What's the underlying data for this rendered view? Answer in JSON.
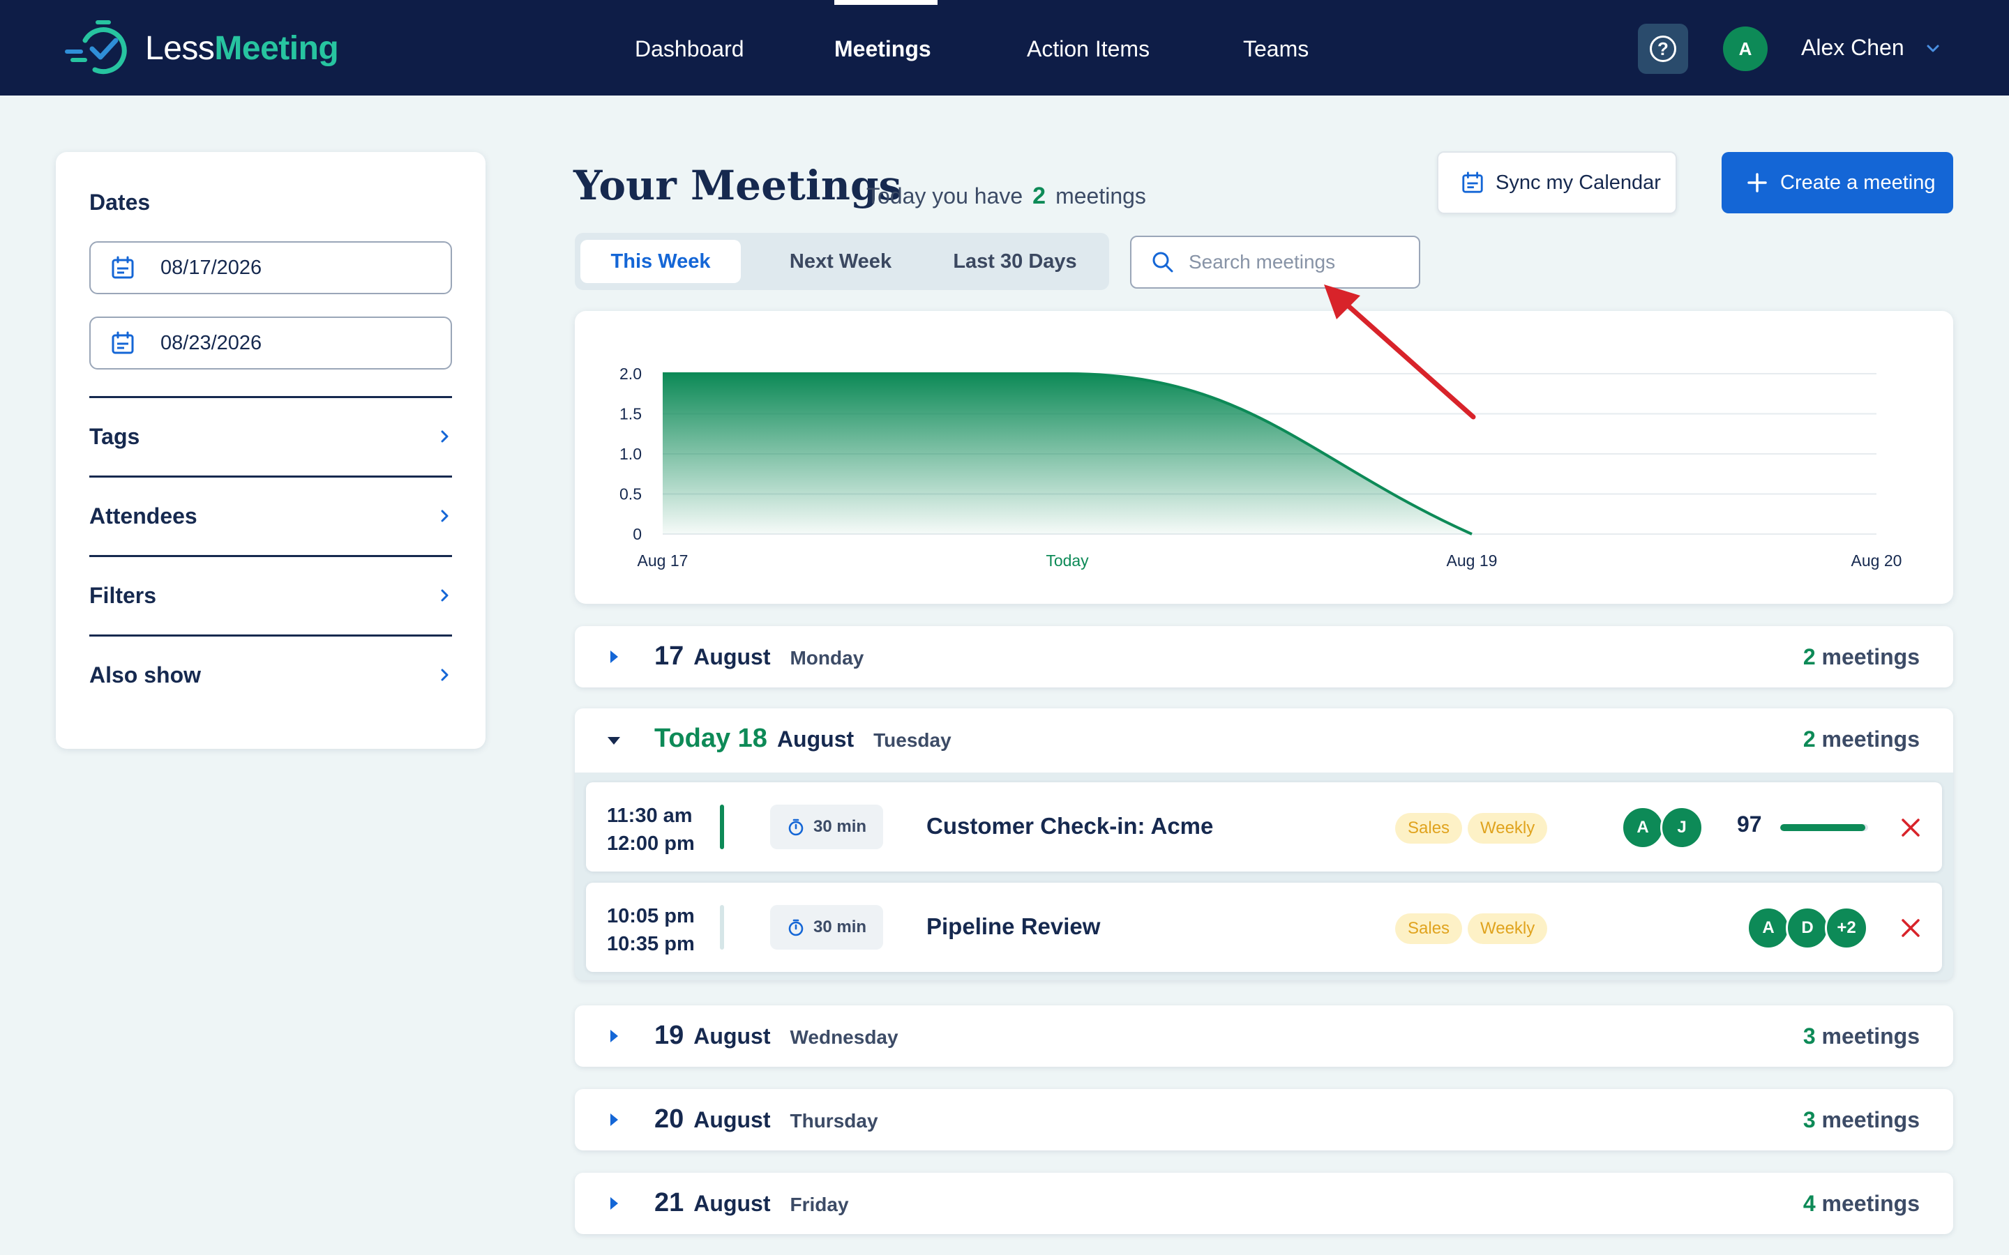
{
  "app": {
    "logo_less": "Less",
    "logo_meeting": "Meeting"
  },
  "nav": {
    "links": [
      "Dashboard",
      "Meetings",
      "Action Items",
      "Teams"
    ],
    "active": "Meetings",
    "help_icon": "question-circle-icon",
    "user_initial": "A",
    "user_name": "Alex Chen"
  },
  "sidebar": {
    "dates_title": "Dates",
    "start_date": "08/17/2026",
    "end_date": "08/23/2026",
    "sections": [
      "Tags",
      "Attendees",
      "Filters",
      "Also show"
    ]
  },
  "header": {
    "title": "Your Meetings",
    "today_prefix": "Today you have",
    "today_count": "2",
    "today_suffix": "meetings",
    "sync_label": "Sync my Calendar",
    "create_label": "Create a meeting"
  },
  "tabs": {
    "items": [
      "This Week",
      "Next Week",
      "Last 30 Days"
    ],
    "active": "This Week"
  },
  "search": {
    "placeholder": "Search meetings",
    "value": ""
  },
  "chart_data": {
    "type": "area",
    "x": [
      "Aug 17",
      "Today",
      "Aug 19",
      "Aug 20"
    ],
    "series": [
      {
        "values": [
          2,
          2,
          0,
          null
        ]
      }
    ],
    "y_ticks": [
      "0",
      "0.5",
      "1.0",
      "1.5",
      "2.0"
    ],
    "ylim": [
      0,
      2
    ],
    "highlight_tick": "Today",
    "grid": true
  },
  "days": [
    {
      "num": "17",
      "month": "August",
      "weekday": "Monday",
      "count": "2",
      "count_label": "meetings",
      "expanded": false,
      "today": false
    },
    {
      "prefix": "Today",
      "num": "18",
      "month": "August",
      "weekday": "Tuesday",
      "count": "2",
      "count_label": "meetings",
      "expanded": true,
      "today": true
    },
    {
      "num": "19",
      "month": "August",
      "weekday": "Wednesday",
      "count": "3",
      "count_label": "meetings",
      "expanded": false,
      "today": false
    },
    {
      "num": "20",
      "month": "August",
      "weekday": "Thursday",
      "count": "3",
      "count_label": "meetings",
      "expanded": false,
      "today": false
    },
    {
      "num": "21",
      "month": "August",
      "weekday": "Friday",
      "count": "4",
      "count_label": "meetings",
      "expanded": false,
      "today": false
    }
  ],
  "meetings": [
    {
      "start": "11:30 am",
      "end": "12:00 pm",
      "duration": "30 min",
      "title": "Customer Check-in: Acme",
      "tags": [
        "Sales",
        "Weekly"
      ],
      "attendees": [
        "A",
        "J"
      ],
      "score": "97",
      "score_fraction": 0.97,
      "bar_color": "#0d8a57"
    },
    {
      "start": "10:05 pm",
      "end": "10:35 pm",
      "duration": "30 min",
      "title": "Pipeline Review",
      "tags": [
        "Sales",
        "Weekly"
      ],
      "attendees": [
        "A",
        "D",
        "+2"
      ],
      "bar_color": "#d6e6e8"
    }
  ],
  "colors": {
    "nav_bg": "#0e1d47",
    "accent_green": "#0d8a57",
    "primary_blue": "#1466d6",
    "remove_red": "#d8232a",
    "tag_bg": "#fdf1c6",
    "tag_text": "#e0a31e"
  }
}
